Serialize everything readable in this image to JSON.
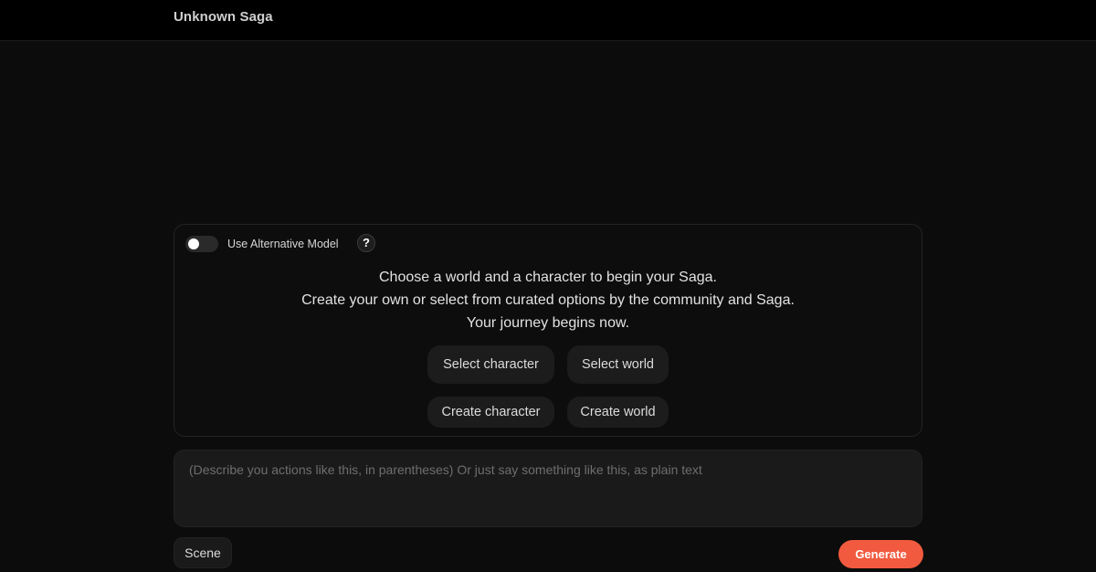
{
  "header": {
    "title": "Unknown Saga"
  },
  "settings": {
    "alt_model_label": "Use Alternative Model",
    "alt_model_enabled": false,
    "help_glyph": "?"
  },
  "intro": {
    "line1": "Choose a world and a character to begin your Saga.",
    "line2": "Create your own or select from curated options by the community and Saga.",
    "line3": "Your journey begins now."
  },
  "actions": {
    "select_character": "Select character",
    "select_world": "Select world",
    "create_character": "Create character",
    "create_world": "Create world"
  },
  "prompt": {
    "placeholder": "(Describe you actions like this, in parentheses) Or just say something like this, as plain text",
    "value": ""
  },
  "footer": {
    "scene_label": "Scene",
    "generate_label": "Generate"
  },
  "colors": {
    "background": "#0c0c0c",
    "topbar": "#000000",
    "accent": "#f15a3f"
  },
  "icons": {
    "help": "question-mark-icon",
    "toggle": "toggle-switch"
  }
}
